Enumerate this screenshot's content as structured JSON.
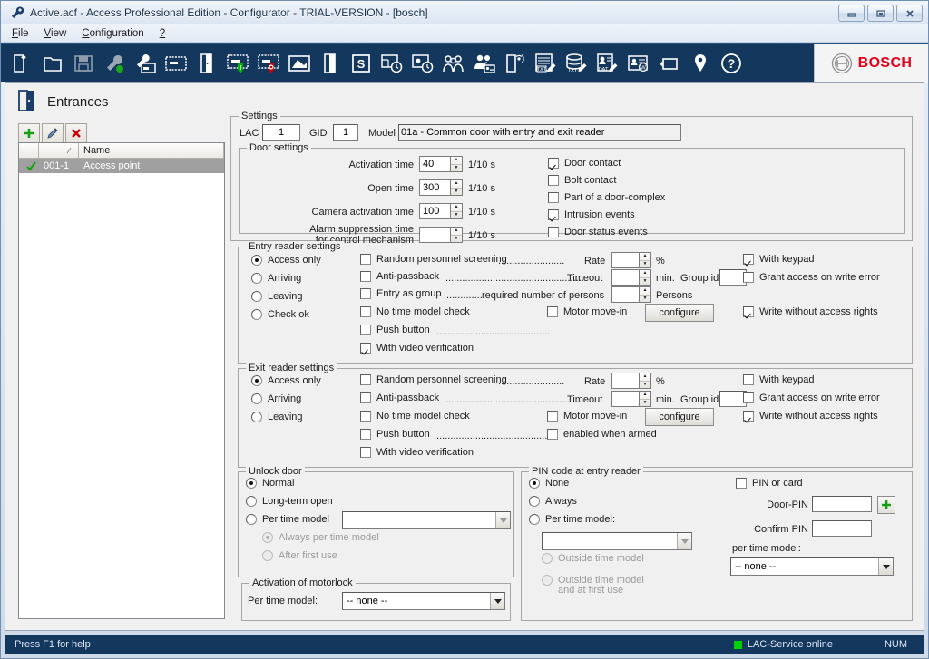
{
  "window": {
    "title": "Active.acf - Access Professional Edition - Configurator - TRIAL-VERSION - [bosch]",
    "icon": "wrench-icon",
    "minimize_label": "Minimize",
    "restore_label": "Restore",
    "close_label": "Close"
  },
  "menu": {
    "items": [
      {
        "label": "File"
      },
      {
        "label": "View"
      },
      {
        "label": "Configuration"
      },
      {
        "label": "?"
      }
    ]
  },
  "toolbar": {
    "buttons": [
      {
        "name": "new-file-icon"
      },
      {
        "name": "open-folder-icon"
      },
      {
        "name": "save-disk-icon"
      },
      {
        "name": "wrench-settings-icon"
      },
      {
        "name": "card-personnel-icon"
      },
      {
        "name": "card-reader-icon"
      },
      {
        "name": "door-icon"
      },
      {
        "name": "card-entry-green-icon"
      },
      {
        "name": "card-exit-red-icon"
      },
      {
        "name": "area-map-icon"
      },
      {
        "name": "door-model-icon"
      },
      {
        "name": "signature-s-icon"
      },
      {
        "name": "floorplan-clock-icon"
      },
      {
        "name": "calendar-clock-icon"
      },
      {
        "name": "persons-group-icon"
      },
      {
        "name": "persons-card-icon"
      },
      {
        "name": "wireless-door-icon"
      },
      {
        "name": "txt-report-edit-icon"
      },
      {
        "name": "txt-export-edit-icon"
      },
      {
        "name": "data-export-edit-icon"
      },
      {
        "name": "card-w-icon"
      },
      {
        "name": "video-camera-icon"
      },
      {
        "name": "location-pin-icon"
      },
      {
        "name": "help-question-icon"
      }
    ],
    "brand": "BOSCH"
  },
  "page": {
    "title": "Entrances",
    "icon": "door-icon"
  },
  "entrance_list": {
    "toolbar": [
      {
        "name": "add-entrance-button",
        "glyph": "+"
      },
      {
        "name": "edit-entrance-button",
        "glyph": "pencil-icon"
      },
      {
        "name": "delete-entrance-button",
        "glyph": "x"
      }
    ],
    "columns": [
      "",
      "",
      "Name"
    ],
    "rows": [
      {
        "status": "check",
        "id": "001-1",
        "name": "Access point",
        "selected": true
      }
    ]
  },
  "settings": {
    "legend": "Settings",
    "lac_label": "LAC",
    "lac_value": "1",
    "gid_label": "GID",
    "gid_value": "1",
    "model_label": "Model",
    "model_value": "01a - Common door with entry and exit reader"
  },
  "door_settings": {
    "legend": "Door settings",
    "fields": [
      {
        "label": "Activation time",
        "value": "40",
        "unit": "1/10 s"
      },
      {
        "label": "Open time",
        "value": "300",
        "unit": "1/10 s"
      },
      {
        "label": "Camera activation time",
        "value": "100",
        "unit": "1/10 s"
      },
      {
        "label": "Alarm suppression time",
        "label2": "for control mechanism",
        "value": "",
        "unit": "1/10 s"
      }
    ],
    "checkboxes": [
      {
        "label": "Door contact",
        "checked": true
      },
      {
        "label": "Bolt contact",
        "checked": false
      },
      {
        "label": "Part of a door-complex",
        "checked": false
      },
      {
        "label": "Intrusion events",
        "checked": true
      },
      {
        "label": "Door status events",
        "checked": false
      }
    ]
  },
  "entry_reader": {
    "legend": "Entry reader settings",
    "modes": [
      {
        "label": "Access only",
        "selected": true
      },
      {
        "label": "Arriving",
        "selected": false
      },
      {
        "label": "Leaving",
        "selected": false
      },
      {
        "label": "Check ok",
        "selected": false
      }
    ],
    "random_screening": {
      "label": "Random personnel screening",
      "dots": "........................",
      "checked": false,
      "rate_label": "Rate",
      "rate_value": "",
      "rate_unit": "%"
    },
    "anti_passback": {
      "label": "Anti-passback",
      "dots": "..................................................",
      "checked": false,
      "timeout_label": "Timeout",
      "timeout_value": "",
      "timeout_unit": "min.",
      "group_label": "Group id",
      "group_value": ""
    },
    "entry_as_group": {
      "label": "Entry as group",
      "dots": "...............",
      "label2": "required number of persons",
      "checked": false,
      "persons_value": "",
      "persons_unit": "Persons"
    },
    "no_time_model": {
      "label": "No time model check",
      "checked": false
    },
    "motor_move_in": {
      "label": "Motor move-in",
      "checked": false
    },
    "configure_button": "configure",
    "push_button": {
      "label": "Push button",
      "dots": "..........................................",
      "checked": false
    },
    "video_verification": {
      "label": "With video verification",
      "checked": true
    },
    "with_keypad": {
      "label": "With keypad",
      "checked": true
    },
    "grant_access_write_error": {
      "label": "Grant access on write error",
      "checked": false
    },
    "write_without_rights": {
      "label": "Write without access rights",
      "checked": true
    }
  },
  "exit_reader": {
    "legend": "Exit reader settings",
    "modes": [
      {
        "label": "Access only",
        "selected": true
      },
      {
        "label": "Arriving",
        "selected": false
      },
      {
        "label": "Leaving",
        "selected": false
      }
    ],
    "random_screening": {
      "label": "Random personnel screening",
      "dots": "........................",
      "checked": false,
      "rate_label": "Rate",
      "rate_value": "",
      "rate_unit": "%"
    },
    "anti_passback": {
      "label": "Anti-passback",
      "dots": "..................................................",
      "checked": false,
      "timeout_label": "Timeout",
      "timeout_value": "",
      "timeout_unit": "min.",
      "group_label": "Group id",
      "group_value": ""
    },
    "no_time_model": {
      "label": "No time model check",
      "checked": false
    },
    "motor_move_in": {
      "label": "Motor move-in",
      "checked": false
    },
    "configure_button": "configure",
    "push_button": {
      "label": "Push button",
      "dots": "..........................................",
      "checked": false
    },
    "enabled_when_armed": {
      "label": "enabled when armed",
      "checked": false
    },
    "video_verification": {
      "label": "With video verification",
      "checked": false
    },
    "with_keypad": {
      "label": "With keypad",
      "checked": false
    },
    "grant_access_write_error": {
      "label": "Grant access on write error",
      "checked": false
    },
    "write_without_rights": {
      "label": "Write without access rights",
      "checked": true
    }
  },
  "unlock_door": {
    "legend": "Unlock door",
    "options": [
      {
        "label": "Normal",
        "selected": true,
        "disabled": false
      },
      {
        "label": "Long-term open",
        "selected": false,
        "disabled": false
      },
      {
        "label": "Per time model",
        "selected": false,
        "disabled": false
      }
    ],
    "time_model_value": "",
    "sub_options": [
      {
        "label": "Always per time model",
        "selected": true,
        "disabled": true
      },
      {
        "label": "After first use",
        "selected": false,
        "disabled": true
      }
    ]
  },
  "motorlock": {
    "legend": "Activation of motorlock",
    "per_time_model_label": "Per time model:",
    "per_time_model_value": "-- none --"
  },
  "pin_code": {
    "legend": "PIN code at entry reader",
    "options": [
      {
        "label": "None",
        "selected": true,
        "disabled": false
      },
      {
        "label": "Always",
        "selected": false,
        "disabled": false
      },
      {
        "label": "Per time model:",
        "selected": false,
        "disabled": false
      }
    ],
    "time_model_value": "",
    "sub_options": [
      {
        "label": "Outside time model",
        "selected": false,
        "disabled": true
      },
      {
        "label": "Outside time model",
        "label2": "and at first use",
        "selected": false,
        "disabled": true
      }
    ],
    "pin_or_card": {
      "label": "PIN or card",
      "checked": false
    },
    "door_pin_label": "Door-PIN",
    "door_pin_value": "",
    "confirm_pin_label": "Confirm PIN",
    "confirm_pin_value": "",
    "per_time_model_label": "per time model:",
    "per_time_model_value": "-- none --",
    "add_button": "add-pin-button"
  },
  "status_bar": {
    "help_text": "Press F1 for help",
    "service_status": "LAC-Service online",
    "status_color": "#00d400",
    "num_indicator": "NUM"
  }
}
